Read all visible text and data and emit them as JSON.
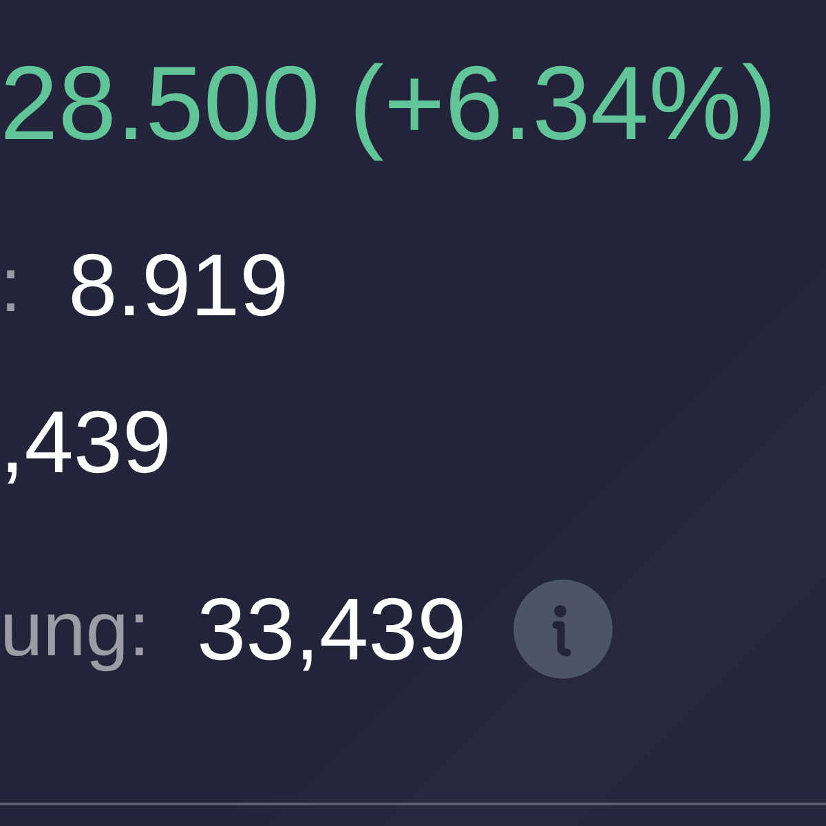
{
  "change": {
    "text": "28.500 (+6.34%)"
  },
  "rows": [
    {
      "label": ":",
      "value": "8.919",
      "info": false
    },
    {
      "value": ",439",
      "info": false
    },
    {
      "label": "ung:",
      "value": "33,439",
      "info": true
    }
  ]
}
